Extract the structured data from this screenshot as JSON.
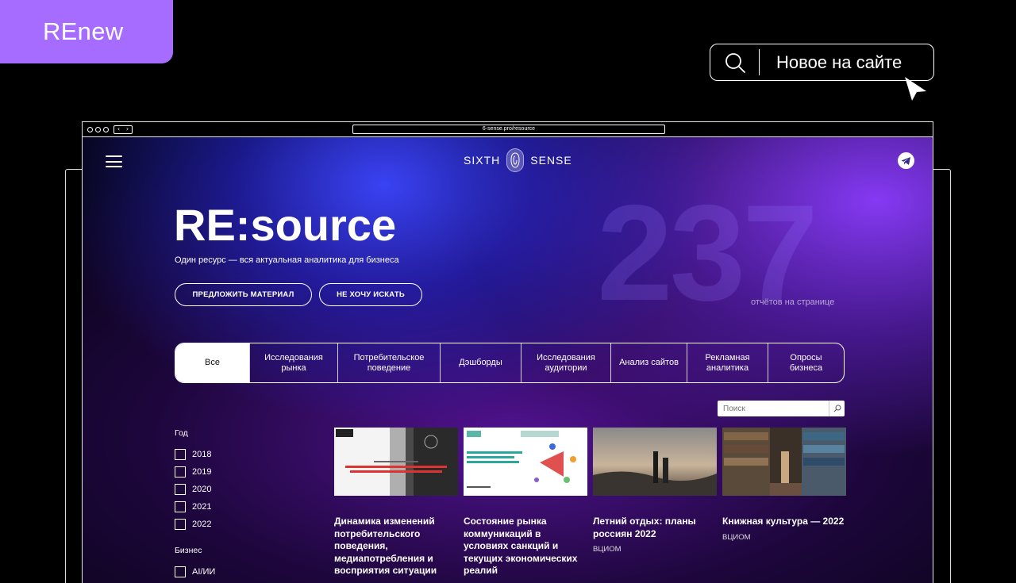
{
  "promo": {
    "tag": "REnew",
    "search_label": "Новое на сайте"
  },
  "browser": {
    "url": "6-sense.pro/resource"
  },
  "site": {
    "logo_left": "SIXTH",
    "logo_right": "SENSE",
    "hero_title": "RE:source",
    "hero_subtitle": "Один ресурс — вся актуальная аналитика для бизнеса",
    "btn_suggest": "ПРЕДЛОЖИТЬ МАТЕРИАЛ",
    "btn_nosearch": "НЕ ХОЧУ ИСКАТЬ",
    "count": "237",
    "count_label": "отчётов на странице",
    "search_placeholder": "Поиск"
  },
  "tabs": [
    {
      "label": "Все",
      "active": true
    },
    {
      "label": "Исследования рынка"
    },
    {
      "label": "Потребительское поведение"
    },
    {
      "label": "Дэшборды"
    },
    {
      "label": "Исследования аудитории"
    },
    {
      "label": "Анализ сайтов"
    },
    {
      "label": "Рекламная аналитика"
    },
    {
      "label": "Опросы бизнеса"
    }
  ],
  "filters": {
    "year_title": "Год",
    "years": [
      "2018",
      "2019",
      "2020",
      "2021",
      "2022"
    ],
    "business_title": "Бизнес",
    "business": [
      "AI/ИИ"
    ]
  },
  "cards": [
    {
      "title": "Динамика изменений потребительского поведения, медиапотребления и восприятия ситуации",
      "source": ""
    },
    {
      "title": "Состояние рынка коммуникаций в условиях санкций и текущих экономических реалий",
      "source": ""
    },
    {
      "title": "Летний отдых: планы россиян 2022",
      "source": "ВЦИОМ"
    },
    {
      "title": "Книжная культура — 2022",
      "source": "ВЦИОМ"
    }
  ],
  "colors": {
    "tag": "#a66bff",
    "background": "#000000",
    "accent_blue": "#3c46ff",
    "accent_purple": "#8c3cff"
  }
}
